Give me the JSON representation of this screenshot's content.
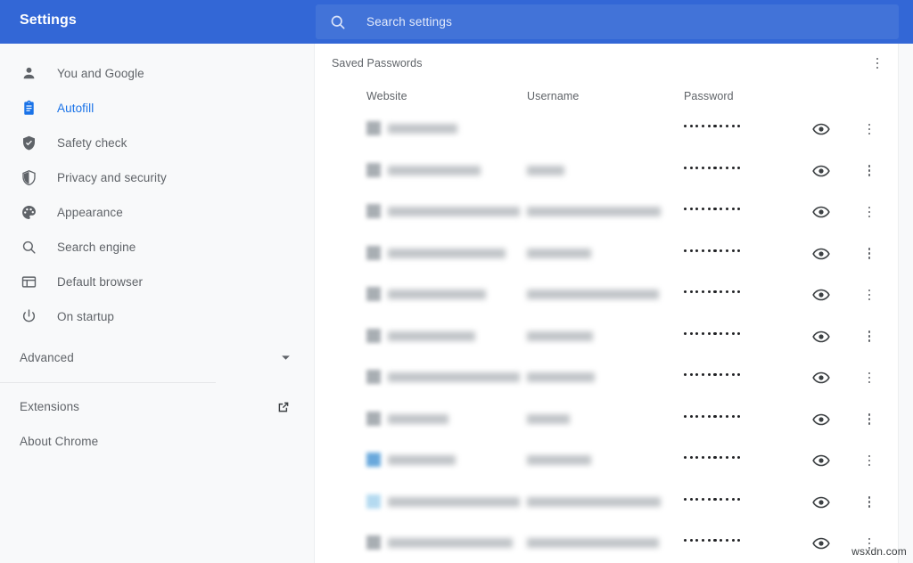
{
  "header": {
    "title": "Settings",
    "search": {
      "placeholder": "Search settings",
      "value": "",
      "icon": "search-icon"
    },
    "bg_color": "#3367d6",
    "search_bg_color": "#4273d8"
  },
  "sidebar": {
    "items": [
      {
        "label": "You and Google",
        "icon": "person-icon",
        "active": false
      },
      {
        "label": "Autofill",
        "icon": "clipboard-icon",
        "active": true
      },
      {
        "label": "Safety check",
        "icon": "shield-check-icon",
        "active": false
      },
      {
        "label": "Privacy and security",
        "icon": "shield-half-icon",
        "active": false
      },
      {
        "label": "Appearance",
        "icon": "palette-icon",
        "active": false
      },
      {
        "label": "Search engine",
        "icon": "search-icon",
        "active": false
      },
      {
        "label": "Default browser",
        "icon": "browser-window-icon",
        "active": false
      },
      {
        "label": "On startup",
        "icon": "power-icon",
        "active": false
      }
    ],
    "advanced": {
      "label": "Advanced",
      "icon": "chevron-down-icon"
    },
    "footer_items": [
      {
        "label": "Extensions",
        "icon": "external-link-icon"
      },
      {
        "label": "About Chrome",
        "icon": ""
      }
    ],
    "active_color": "#1a73e8",
    "text_color": "#5f6368"
  },
  "main": {
    "section_title": "Saved Passwords",
    "section_menu_icon": "more-vert-icon",
    "columns": [
      "Website",
      "Username",
      "Password"
    ],
    "password_mask": "••••••••••",
    "password_dot_count": 10,
    "row_show_icon": "eye-icon",
    "row_menu_icon": "more-vert-icon",
    "rows": [
      {
        "website_redacted": true,
        "website_w": 78,
        "username_redacted": false,
        "username_w": 0,
        "favicon_color": "#9aa0a6"
      },
      {
        "website_redacted": true,
        "website_w": 104,
        "username_redacted": true,
        "username_w": 42,
        "favicon_color": "#9aa0a6"
      },
      {
        "website_redacted": true,
        "website_w": 148,
        "username_redacted": true,
        "username_w": 150,
        "favicon_color": "#9aa0a6"
      },
      {
        "website_redacted": true,
        "website_w": 132,
        "username_redacted": true,
        "username_w": 72,
        "favicon_color": "#9aa0a6"
      },
      {
        "website_redacted": true,
        "website_w": 110,
        "username_redacted": true,
        "username_w": 148,
        "favicon_color": "#9aa0a6"
      },
      {
        "website_redacted": true,
        "website_w": 98,
        "username_redacted": true,
        "username_w": 74,
        "favicon_color": "#9aa0a6"
      },
      {
        "website_redacted": true,
        "website_w": 148,
        "username_redacted": true,
        "username_w": 76,
        "favicon_color": "#9aa0a6"
      },
      {
        "website_redacted": true,
        "website_w": 68,
        "username_redacted": true,
        "username_w": 48,
        "favicon_color": "#9aa0a6"
      },
      {
        "website_redacted": true,
        "website_w": 76,
        "username_redacted": true,
        "username_w": 72,
        "favicon_color": "#4f9ad6"
      },
      {
        "website_redacted": true,
        "website_w": 148,
        "username_redacted": true,
        "username_w": 150,
        "favicon_color": "#a8d4ee"
      },
      {
        "website_redacted": true,
        "website_w": 140,
        "username_redacted": true,
        "username_w": 148,
        "favicon_color": "#9aa0a6"
      }
    ]
  },
  "watermark": {
    "text": "wsxdn.com"
  }
}
